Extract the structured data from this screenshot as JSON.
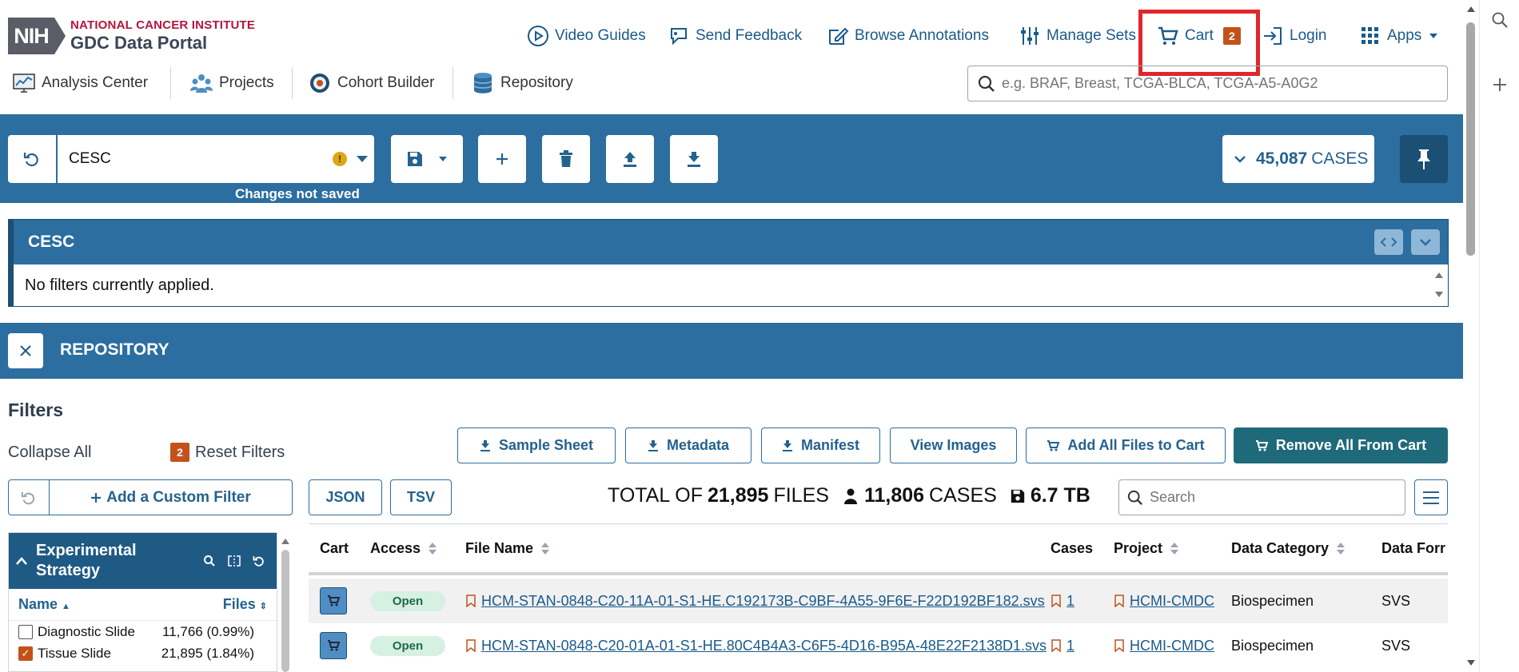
{
  "logo": {
    "line1": "NATIONAL CANCER INSTITUTE",
    "line2": "GDC Data Portal",
    "mark": "NIH"
  },
  "topnav": {
    "video_guides": "Video Guides",
    "send_feedback": "Send Feedback",
    "browse_annotations": "Browse Annotations",
    "manage_sets": "Manage Sets",
    "cart": "Cart",
    "cart_count": "2",
    "login": "Login",
    "apps": "Apps"
  },
  "subnav": {
    "analysis_center": "Analysis Center",
    "projects": "Projects",
    "cohort_builder": "Cohort Builder",
    "repository": "Repository"
  },
  "search": {
    "placeholder": "e.g. BRAF, Breast, TCGA-BLCA, TCGA-A5-A0G2"
  },
  "cohort": {
    "name": "CESC",
    "warning": "!",
    "changes_not_saved": "Changes not saved",
    "cases_count": "45,087",
    "cases_label": "CASES"
  },
  "filter_panel": {
    "title": "CESC",
    "empty_text": "No filters currently applied."
  },
  "repository": {
    "title": "REPOSITORY",
    "filters_title": "Filters",
    "collapse_all": "Collapse All",
    "reset_count": "2",
    "reset_filters": "Reset Filters",
    "add_custom_filter": "Add a Custom Filter"
  },
  "facet": {
    "title": "Experimental Strategy",
    "col_name": "Name",
    "col_files": "Files",
    "rows": [
      {
        "label": "Diagnostic Slide",
        "count": "11,766 (0.99%)",
        "checked": false
      },
      {
        "label": "Tissue Slide",
        "count": "21,895 (1.84%)",
        "checked": true
      }
    ]
  },
  "actions": {
    "sample_sheet": "Sample Sheet",
    "metadata": "Metadata",
    "manifest": "Manifest",
    "view_images": "View Images",
    "add_all": "Add All Files to Cart",
    "remove_all": "Remove All From Cart",
    "json": "JSON",
    "tsv": "TSV"
  },
  "totals": {
    "prefix": "TOTAL OF",
    "files_count": "21,895",
    "files_label": "FILES",
    "cases_count": "11,806",
    "cases_label": "CASES",
    "size": "6.7 TB"
  },
  "table": {
    "search_placeholder": "Search",
    "headers": {
      "cart": "Cart",
      "access": "Access",
      "file_name": "File Name",
      "cases": "Cases",
      "project": "Project",
      "data_category": "Data Category",
      "data_format": "Data Forr"
    },
    "rows": [
      {
        "access": "Open",
        "file_name": "HCM-STAN-0848-C20-11A-01-S1-HE.C192173B-C9BF-4A55-9F6E-F22D192BF182.svs",
        "cases": "1",
        "project": "HCMI-CMDC",
        "data_category": "Biospecimen",
        "data_format": "SVS"
      },
      {
        "access": "Open",
        "file_name": "HCM-STAN-0848-C20-01A-01-S1-HE.80C4B4A3-C6F5-4D16-B95A-48E22F2138D1.svs",
        "cases": "1",
        "project": "HCMI-CMDC",
        "data_category": "Biospecimen",
        "data_format": "SVS"
      }
    ]
  },
  "colors": {
    "primary": "#2b6e9f",
    "dark": "#1b4f73",
    "accent_badge": "#c2521a",
    "highlight": "#e0262b",
    "teal_button": "#1f6a7a"
  }
}
